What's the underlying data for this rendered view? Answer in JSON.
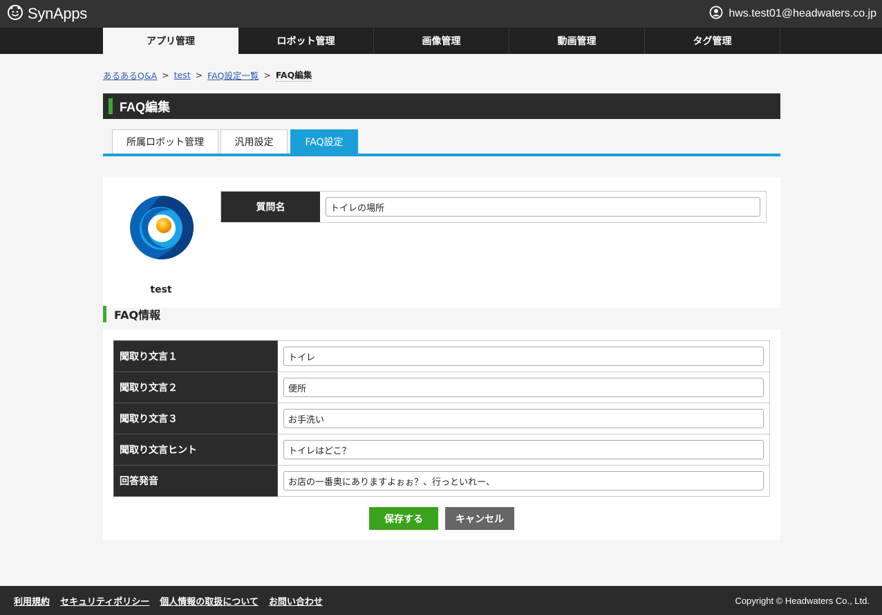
{
  "header": {
    "brand": "SynApps",
    "user_email": "hws.test01@headwaters.co.jp"
  },
  "main_nav": {
    "items": [
      {
        "label": "アプリ管理",
        "active": true
      },
      {
        "label": "ロボット管理",
        "active": false
      },
      {
        "label": "画像管理",
        "active": false
      },
      {
        "label": "動画管理",
        "active": false
      },
      {
        "label": "タグ管理",
        "active": false
      }
    ]
  },
  "breadcrumb": {
    "items": [
      "あるあるQ&A",
      "test",
      "FAQ設定一覧"
    ],
    "current": "FAQ編集",
    "separator": ">"
  },
  "page": {
    "title": "FAQ編集"
  },
  "sub_tabs": {
    "items": [
      {
        "label": "所属ロボット管理",
        "active": false
      },
      {
        "label": "汎用設定",
        "active": false
      },
      {
        "label": "FAQ設定",
        "active": true
      }
    ]
  },
  "robot": {
    "name": "test"
  },
  "question": {
    "label": "質問名",
    "value": "トイレの場所"
  },
  "faq_section": {
    "title": "FAQ情報",
    "rows": [
      {
        "label": "聞取り文言１",
        "value": "トイレ"
      },
      {
        "label": "聞取り文言２",
        "value": "便所"
      },
      {
        "label": "聞取り文言３",
        "value": "お手洗い"
      },
      {
        "label": "聞取り文言ヒント",
        "value": "トイレはどこ？"
      },
      {
        "label": "回答発音",
        "value": "お店の一番奥にありますよぉぉ？、行っといれー、"
      }
    ]
  },
  "actions": {
    "save": "保存する",
    "cancel": "キャンセル"
  },
  "footer": {
    "links": [
      "利用規約",
      "セキュリティポリシー",
      "個人情報の取扱について",
      "お問い合わせ"
    ],
    "copyright": "Copyright © Headwaters Co., Ltd."
  },
  "colors": {
    "accent_blue": "#1a9fd8",
    "accent_green": "#3aaa35",
    "save_green": "#3aa21c",
    "dark": "#2b2b2b"
  }
}
